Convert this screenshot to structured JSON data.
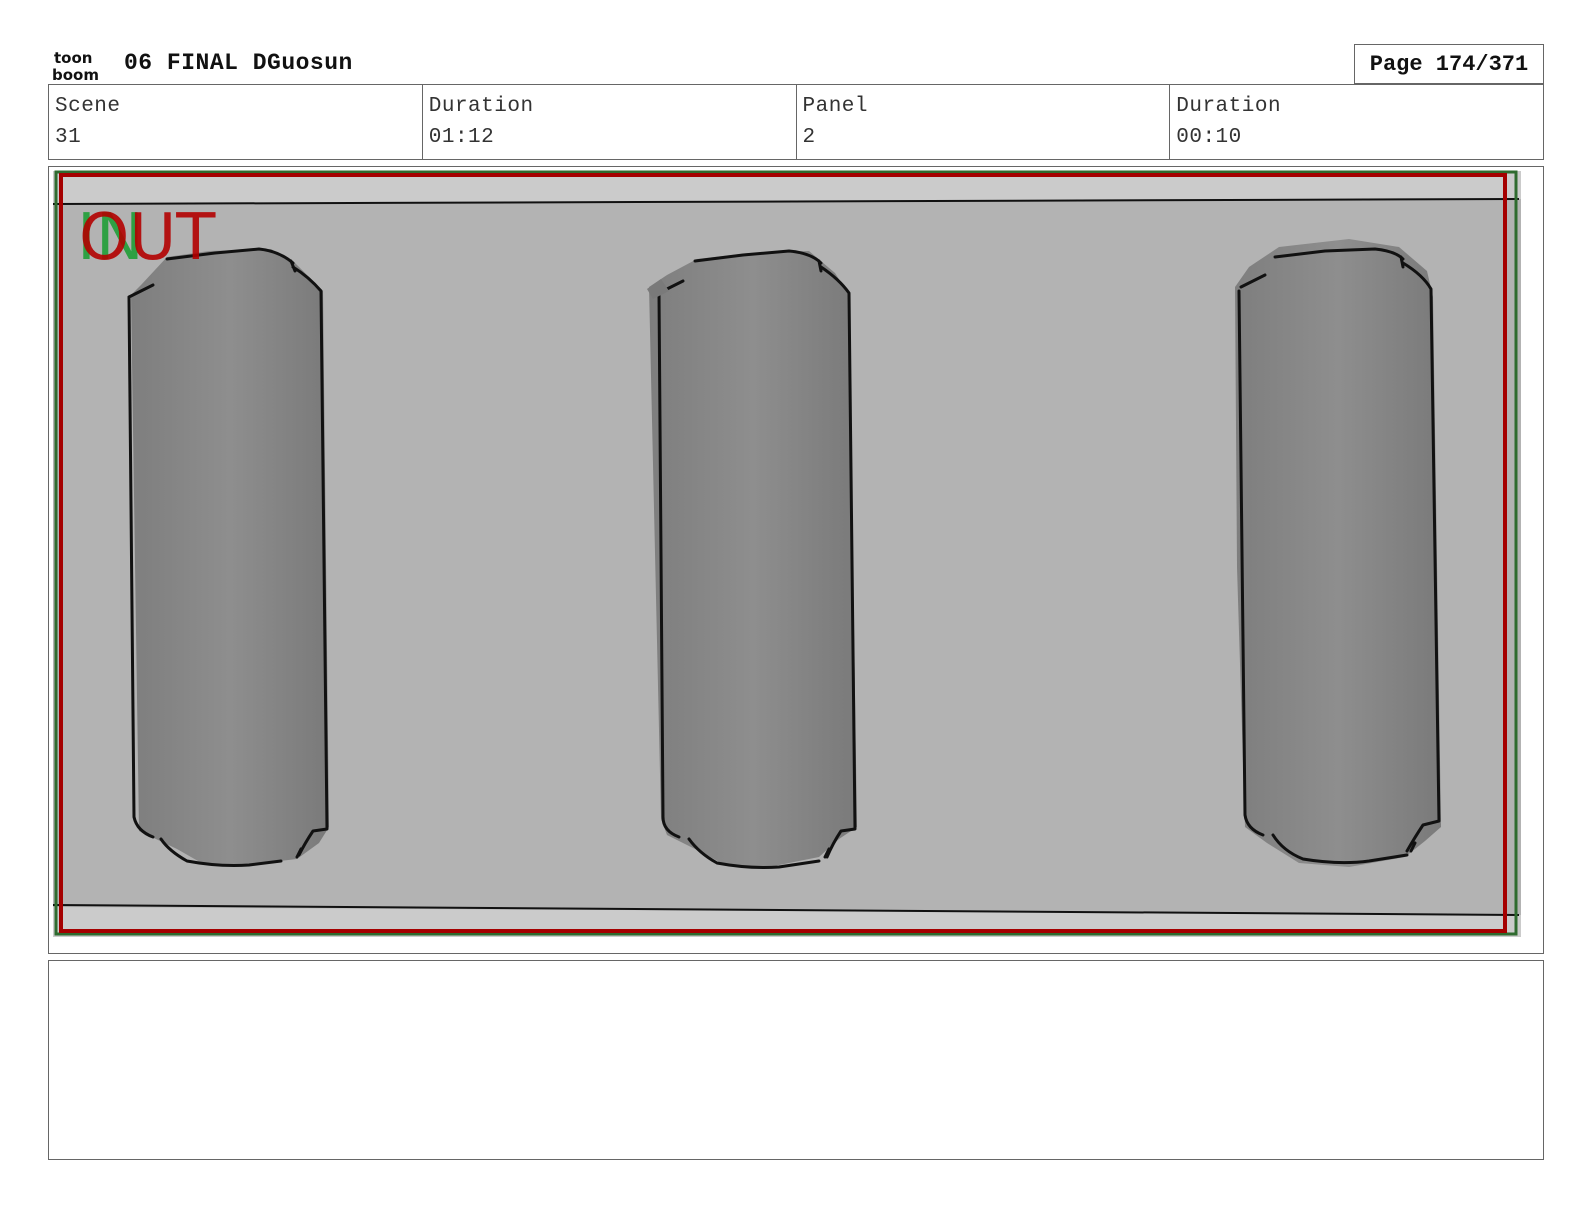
{
  "header": {
    "logo_text_top": "toon",
    "logo_text_bottom": "boom",
    "title": "06 FINAL DGuosun",
    "page": "Page 174/371"
  },
  "info": [
    {
      "label": "Scene",
      "value": "31"
    },
    {
      "label": "Duration",
      "value": "01:12"
    },
    {
      "label": "Panel",
      "value": "2"
    },
    {
      "label": "Duration",
      "value": "00:10"
    }
  ],
  "panel": {
    "in_marker": "IN",
    "out_marker": "OUT",
    "colors": {
      "in_green": "#2ea043",
      "out_red": "#b30000",
      "frame_dark_red": "#8b1010",
      "background": "#b3b3b3",
      "band": "#cccccc",
      "tube_fill": "#8a8a8a"
    }
  },
  "notes": {
    "text": ""
  }
}
